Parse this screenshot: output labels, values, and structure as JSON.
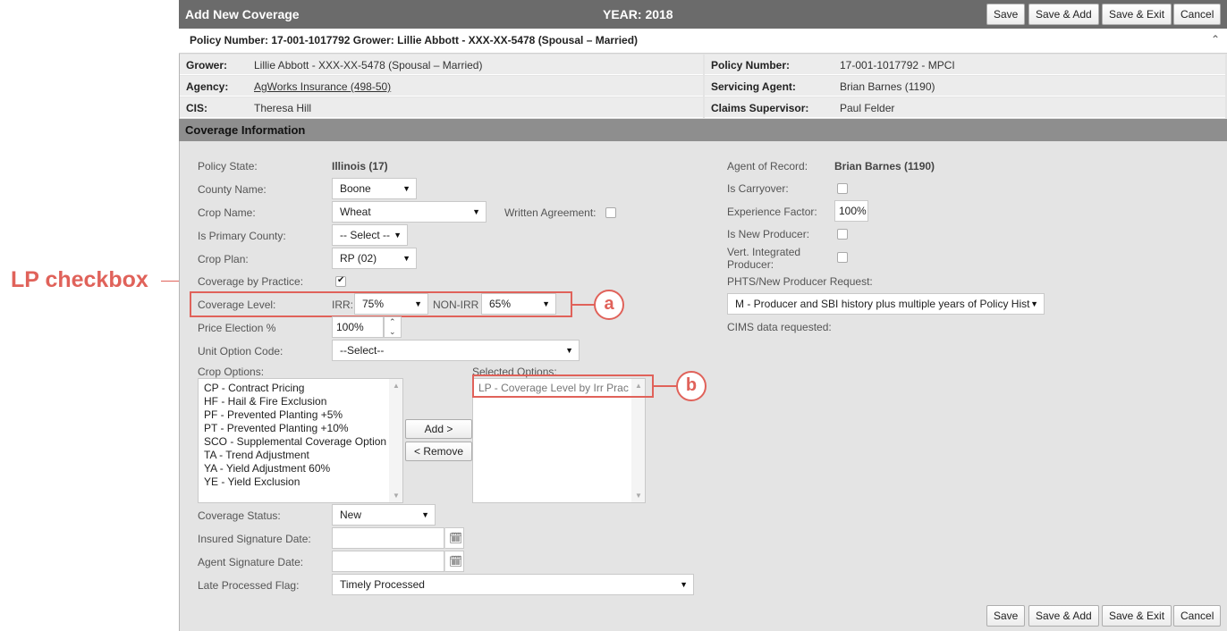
{
  "annotation": {
    "lp_checkbox_label": "LP checkbox",
    "callout_a": "a",
    "callout_b": "b"
  },
  "header": {
    "title": "Add New Coverage",
    "year": "YEAR: 2018",
    "buttons": {
      "save": "Save",
      "save_add": "Save & Add",
      "save_exit": "Save & Exit",
      "cancel": "Cancel"
    }
  },
  "policy_bar": {
    "text": "Policy Number: 17-001-1017792 Grower: Lillie Abbott - XXX-XX-5478 (Spousal – Married)",
    "collapse_icon": "chevron-up"
  },
  "info": {
    "grower_label": "Grower:",
    "grower_value": "Lillie Abbott - XXX-XX-5478 (Spousal – Married)",
    "agency_label": "Agency:",
    "agency_value": "AgWorks Insurance (498-50)",
    "cis_label": "CIS:",
    "cis_value": "Theresa Hill",
    "policy_label": "Policy Number:",
    "policy_value": "17-001-1017792 - MPCI",
    "agent_label": "Servicing Agent:",
    "agent_value": "Brian Barnes (1190)",
    "claims_label": "Claims Supervisor:",
    "claims_value": "Paul Felder"
  },
  "section": {
    "title": "Coverage Information"
  },
  "form": {
    "policy_state_label": "Policy State:",
    "policy_state_value": "Illinois (17)",
    "county_label": "County Name:",
    "county_value": "Boone",
    "crop_label": "Crop Name:",
    "crop_value": "Wheat",
    "written_agreement_label": "Written Agreement:",
    "primary_county_label": "Is Primary County:",
    "primary_county_value": "-- Select --",
    "crop_plan_label": "Crop Plan:",
    "crop_plan_value": "RP (02)",
    "coverage_by_practice_label": "Coverage by Practice:",
    "coverage_level_label": "Coverage Level:",
    "irr_label": "IRR:",
    "irr_value": "75%",
    "nonirr_label": "NON-IRR",
    "nonirr_value": "65%",
    "price_election_label": "Price Election %",
    "price_election_value": "100%",
    "unit_option_label": "Unit Option Code:",
    "unit_option_value": "--Select--",
    "crop_options_label": "Crop Options:",
    "crop_options": [
      "CP - Contract Pricing",
      "HF - Hail & Fire Exclusion",
      "PF - Prevented Planting +5%",
      "PT - Prevented Planting +10%",
      "SCO - Supplemental Coverage Option",
      "TA - Trend Adjustment",
      "YA - Yield Adjustment 60%",
      "YE - Yield Exclusion"
    ],
    "add_button": "Add >",
    "remove_button": "< Remove",
    "selected_options_label": "Selected Options:",
    "selected_options": [
      "LP - Coverage Level by Irr Prac"
    ],
    "coverage_status_label": "Coverage Status:",
    "coverage_status_value": "New",
    "insured_sig_label": "Insured Signature Date:",
    "agent_sig_label": "Agent Signature Date:",
    "late_processed_label": "Late Processed Flag:",
    "late_processed_value": "Timely Processed",
    "agent_of_record_label": "Agent of Record:",
    "agent_of_record_value": "Brian Barnes (1190)",
    "carryover_label": "Is Carryover:",
    "experience_label": "Experience Factor:",
    "experience_value": "100%",
    "new_producer_label": "Is New Producer:",
    "vert_label_1": "Vert. Integrated",
    "vert_label_2": "Producer:",
    "phts_label": "PHTS/New Producer Request:",
    "phts_value": "M - Producer and SBI history plus multiple years of Policy Hist",
    "cims_label": "CIMS data requested:"
  }
}
